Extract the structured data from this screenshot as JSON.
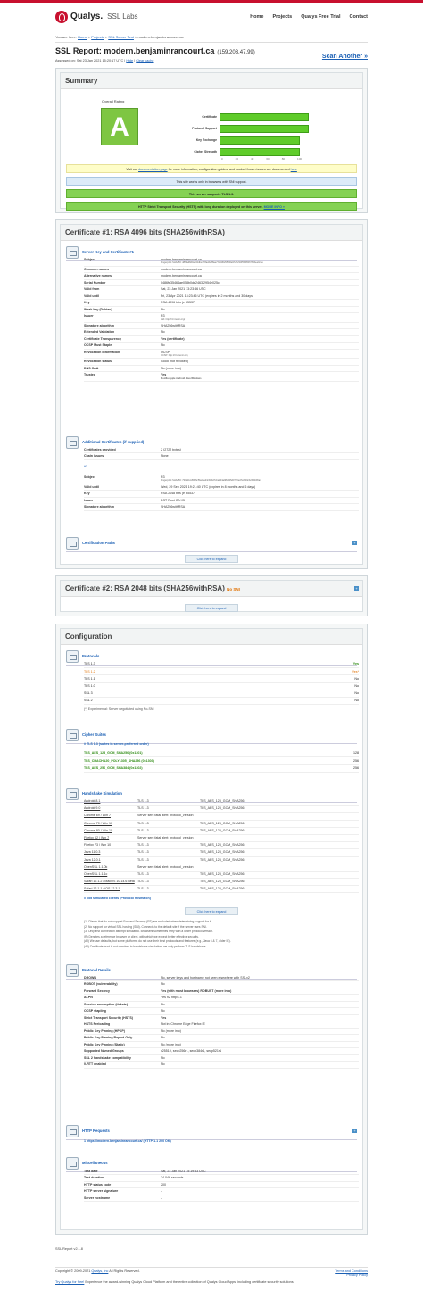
{
  "header": {
    "brand": "Qualys.",
    "product": "SSL Labs",
    "nav": [
      "Home",
      "Projects",
      "Qualys Free Trial",
      "Contact"
    ]
  },
  "breadcrumb": {
    "prefix": "You are here:",
    "items": [
      "Home",
      "Projects",
      "SSL Server Test"
    ],
    "current": "modern.benjaminrancourt.ca"
  },
  "report": {
    "title": "SSL Report: modern.benjaminrancourt.ca",
    "ip": "(159.203.47.99)",
    "assessed_prefix": "Assessed on: Sat 23 Jan 2021 15:20:17 UTC |",
    "hide": "Hide",
    "sep": "|",
    "clear": "Clear cache",
    "scan_another": "Scan Another »"
  },
  "summary": {
    "title": "Summary",
    "overall_label": "Overall Rating",
    "grade": "A",
    "bars": [
      {
        "label": "Certificate",
        "value": 100
      },
      {
        "label": "Protocol Support",
        "value": 100
      },
      {
        "label": "Key Exchange",
        "value": 90
      },
      {
        "label": "Cipher Strength",
        "value": 90
      }
    ],
    "axis": [
      "0",
      "20",
      "40",
      "60",
      "80",
      "100"
    ],
    "notices": [
      {
        "text_pre": "Visit our",
        "link": "documentation page",
        "text_post": "for more information, configuration guides, and books. Known issues are documented",
        "link2": "here",
        "style": "yellow"
      },
      {
        "text": "This site works only in browsers with SNI support.",
        "style": "blue"
      },
      {
        "text": "This server supports TLS 1.3.",
        "style": "green"
      },
      {
        "text": "HTTP Strict Transport Security (HSTS) with long duration deployed on this server.",
        "link": "MORE INFO »",
        "style": "green"
      }
    ]
  },
  "cert1": {
    "title": "Certificate #1: RSA 4096 bits (SHA256withRSA)",
    "section": "Server Key and Certificate #1",
    "rows": [
      {
        "k": "Subject",
        "v": "modern.benjaminrancourt.ca",
        "small": "Fingerprint SHA256: d86fad8d0ac02dbe778a2de88ae7f1a9f02953f2a97e7234f5538f46764bee0c5e"
      },
      {
        "k": "Common names",
        "v": "modern.benjaminrancourt.ca"
      },
      {
        "k": "Alternative names",
        "v": "modern.benjaminrancourt.ca"
      },
      {
        "k": "Serial Number",
        "v": "0486fe35464ae058b0de2463f2954e025c"
      },
      {
        "k": "Valid from",
        "v": "Sat, 23 Jan 2021 13:23:46 UTC"
      },
      {
        "k": "Valid until",
        "v": "Fri, 23 Apr 2021 13:23:46 UTC (expires in 2 months and 30 days)"
      },
      {
        "k": "Key",
        "v": "RSA 4096 bits (e 65537)"
      },
      {
        "k": "Weak key (Debian)",
        "v": "No"
      },
      {
        "k": "Issuer",
        "v": "R3",
        "small": "AIA: http://r3.i.lencr.org/"
      },
      {
        "k": "Signature algorithm",
        "v": "SHA256withRSA"
      },
      {
        "k": "Extended Validation",
        "v": "No"
      },
      {
        "k": "Certificate Transparency",
        "v": "Yes (certificate)",
        "cls": "green-txt"
      },
      {
        "k": "OCSP Must Staple",
        "v": "No"
      },
      {
        "k": "Revocation information",
        "v": "OCSP",
        "small": "OCSP: http://r3.o.lencr.org"
      },
      {
        "k": "Revocation status",
        "v": "Good (not revoked)"
      },
      {
        "k": "DNS CAA",
        "v": "No (more info)",
        "cls": "orange-txt"
      },
      {
        "k": "Trusted",
        "v": "Yes",
        "small": "Mozilla  Apple  Android  Java  Windows",
        "cls": "green-txt"
      }
    ],
    "additional": "Additional Certificates (if supplied)",
    "add_rows": [
      {
        "k": "Certificates provided",
        "v": "2 (2722 bytes)"
      },
      {
        "k": "Chain issues",
        "v": "None"
      }
    ],
    "num": "#2",
    "rows2": [
      {
        "k": "Subject",
        "v": "R3",
        "small": "Fingerprint SHA256: 730c1bcd5bf6c5fa4aa23cb6bd7cbab04a98c3b5d0776ed7ef1b9cb2b3b3f0a7"
      },
      {
        "k": "Valid until",
        "v": "Wed, 29 Sep 2021 19:21:40 UTC (expires in 8 months and 6 days)"
      },
      {
        "k": "Key",
        "v": "RSA 2048 bits (e 65537)"
      },
      {
        "k": "Issuer",
        "v": "DST Root CA X3"
      },
      {
        "k": "Signature algorithm",
        "v": "SHA256withRSA"
      }
    ],
    "paths": "Certification Paths",
    "expand": "Click here to expand"
  },
  "cert2": {
    "title": "Certificate #2: RSA 2048 bits (SHA256withRSA)",
    "warn": "No SNI",
    "expand": "Click here to expand"
  },
  "config": {
    "title": "Configuration",
    "protocols_title": "Protocols",
    "protocols": [
      {
        "n": "TLS 1.3",
        "v": "Yes",
        "c": "green"
      },
      {
        "n": "TLS 1.2",
        "v": "Yes*",
        "c": "orange"
      },
      {
        "n": "TLS 1.1",
        "v": "No",
        "c": ""
      },
      {
        "n": "TLS 1.0",
        "v": "No",
        "c": ""
      },
      {
        "n": "SSL 3",
        "v": "No",
        "c": ""
      },
      {
        "n": "SSL 2",
        "v": "No",
        "c": ""
      }
    ],
    "protocol_note": "(*) Experimental: Server negotiated using No-SNI",
    "cipher_title": "Cipher Suites",
    "cipher_group": "# TLS 1.3 (suites in server-preferred order)",
    "ciphers": [
      {
        "n": "TLS_AES_128_GCM_SHA256 (0x1301)",
        "v": "128"
      },
      {
        "n": "TLS_CHACHA20_POLY1305_SHA256 (0x1303)",
        "v": "256"
      },
      {
        "n": "TLS_AES_256_GCM_SHA384 (0x1302)",
        "v": "256"
      }
    ],
    "hs_title": "Handshake Simulation",
    "handshakes": [
      {
        "c": "Android 8.1",
        "r": "TLS 1.3",
        "s": "TLS_AES_128_GCM_SHA256"
      },
      {
        "c": "Android 9.0",
        "r": "TLS 1.3",
        "s": "TLS_AES_128_GCM_SHA256"
      },
      {
        "c": "Chrome 69 / Win 7",
        "r": "Server sent fatal alert: protocol_version",
        "s": "",
        "err": true
      },
      {
        "c": "Chrome 70 / Win 10",
        "r": "TLS 1.3",
        "s": "TLS_AES_128_GCM_SHA256"
      },
      {
        "c": "Chrome 80 / Win 10",
        "r": "TLS 1.3",
        "s": "TLS_AES_128_GCM_SHA256"
      },
      {
        "c": "Firefox 62 / Win 7",
        "r": "Server sent fatal alert: protocol_version",
        "s": "",
        "err": true
      },
      {
        "c": "Firefox 73 / Win 10",
        "r": "TLS 1.3",
        "s": "TLS_AES_128_GCM_SHA256"
      },
      {
        "c": "Java 11.0.3",
        "r": "TLS 1.3",
        "s": "TLS_AES_128_GCM_SHA256"
      },
      {
        "c": "Java 12.0.1",
        "r": "TLS 1.3",
        "s": "TLS_AES_128_GCM_SHA256"
      },
      {
        "c": "OpenSSL 1.1.0k",
        "r": "Server sent fatal alert: protocol_version",
        "s": "",
        "err": true
      },
      {
        "c": "OpenSSL 1.1.1c",
        "r": "TLS 1.3",
        "s": "TLS_AES_128_GCM_SHA256"
      },
      {
        "c": "Safari 12.1.2 / MacOS 10.14.6 Beta",
        "r": "TLS 1.3",
        "s": "TLS_AES_128_GCM_SHA256"
      },
      {
        "c": "Safari 12.1.1 / iOS 12.3.1",
        "r": "TLS 1.3",
        "s": "TLS_AES_128_GCM_SHA256"
      }
    ],
    "hs_not_simulated": "# Not simulated clients (Protocol mismatch)",
    "hs_expand": "Click here to expand",
    "hs_notes": [
      "(1) Clients that do not support Forward Secrecy (FS) are excluded when determining support for it.",
      "(2) No support for virtual SSL hosting (SNI). Connects to the default site if the server uses SNI.",
      "(3) Only first connection attempt simulated. Browsers sometimes retry with a lower protocol version.",
      "(R) Denotes a reference browser or client, with which we expect better effective security.",
      "(All) We use defaults, but some platforms do not use their best protocols and features (e.g., Java 6 & 7, older IE).",
      "(All) Certificate trust is not checked in handshake simulation, we only perform TLS handshake."
    ],
    "pd_title": "Protocol Details",
    "pd_rows": [
      {
        "k": "DROWN",
        "v": "No, server keys and hostname not seen elsewhere with SSLv2"
      },
      {
        "k": "ROBOT (vulnerability)",
        "v": "No"
      },
      {
        "k": "Forward Secrecy",
        "v": "Yes (with most browsers)   ROBUST (more info)",
        "cls": "green-txt"
      },
      {
        "k": "ALPN",
        "v": "Yes   h2 http/1.1"
      },
      {
        "k": "Session resumption (tickets)",
        "v": "No"
      },
      {
        "k": "OCSP stapling",
        "v": "No"
      },
      {
        "k": "Strict Transport Security (HSTS)",
        "v": "Yes",
        "cls": "green-txt"
      },
      {
        "k": "HSTS Preloading",
        "v": "Not in: Chrome  Edge  Firefox  IE"
      },
      {
        "k": "Public Key Pinning (HPKP)",
        "v": "No (more info)"
      },
      {
        "k": "Public Key Pinning Report-Only",
        "v": "No"
      },
      {
        "k": "Public Key Pinning (Static)",
        "v": "No (more info)"
      },
      {
        "k": "Supported Named Groups",
        "v": "x25519, secp256r1, secp384r1, secp521r1"
      },
      {
        "k": "SSL 2 handshake compatibility",
        "v": "No"
      },
      {
        "k": "0-RTT enabled",
        "v": "No"
      }
    ],
    "http_title": "HTTP Requests",
    "http_row": "1  https://modern.benjaminrancourt.ca/ (HTTP/1.1 200 OK)",
    "misc_title": "Miscellaneous",
    "misc_rows": [
      {
        "k": "Test date",
        "v": "Sat, 23 Jan 2021 15:19:53 UTC"
      },
      {
        "k": "Test duration",
        "v": "24.046 seconds"
      },
      {
        "k": "HTTP status code",
        "v": "200"
      },
      {
        "k": "HTTP server signature",
        "v": "-"
      },
      {
        "k": "Server hostname",
        "v": "-"
      }
    ]
  },
  "footer": {
    "version": "SSL Report v2.1.8",
    "copyright": "Copyright © 2009-2021",
    "company": "Qualys, Inc",
    "rights": "All Rights Reserved.",
    "privacy": "Privacy Policy",
    "terms": "Terms and Conditions",
    "trial_link": "Try Qualys for free!",
    "trial_text": "Experience the award-winning Qualys Cloud Platform and the entire collection of Qualys Cloud Apps, including certificate security solutions."
  }
}
